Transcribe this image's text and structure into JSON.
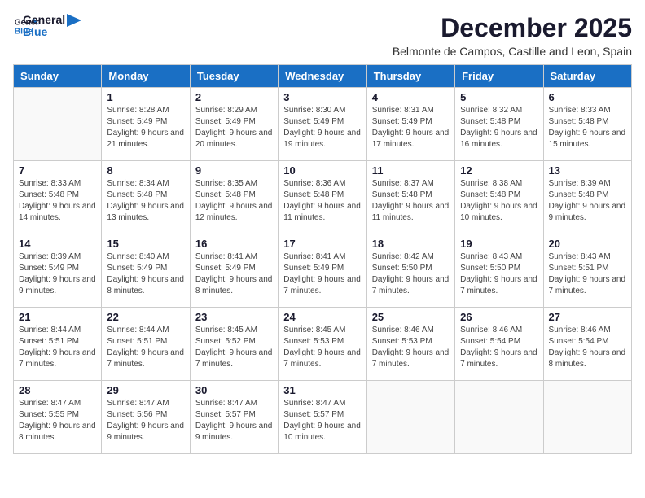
{
  "logo": {
    "text_general": "General",
    "text_blue": "Blue"
  },
  "title": "December 2025",
  "subtitle": "Belmonte de Campos, Castille and Leon, Spain",
  "days_of_week": [
    "Sunday",
    "Monday",
    "Tuesday",
    "Wednesday",
    "Thursday",
    "Friday",
    "Saturday"
  ],
  "weeks": [
    [
      {
        "day": "",
        "sunrise": "",
        "sunset": "",
        "daylight": ""
      },
      {
        "day": "1",
        "sunrise": "Sunrise: 8:28 AM",
        "sunset": "Sunset: 5:49 PM",
        "daylight": "Daylight: 9 hours and 21 minutes."
      },
      {
        "day": "2",
        "sunrise": "Sunrise: 8:29 AM",
        "sunset": "Sunset: 5:49 PM",
        "daylight": "Daylight: 9 hours and 20 minutes."
      },
      {
        "day": "3",
        "sunrise": "Sunrise: 8:30 AM",
        "sunset": "Sunset: 5:49 PM",
        "daylight": "Daylight: 9 hours and 19 minutes."
      },
      {
        "day": "4",
        "sunrise": "Sunrise: 8:31 AM",
        "sunset": "Sunset: 5:49 PM",
        "daylight": "Daylight: 9 hours and 17 minutes."
      },
      {
        "day": "5",
        "sunrise": "Sunrise: 8:32 AM",
        "sunset": "Sunset: 5:48 PM",
        "daylight": "Daylight: 9 hours and 16 minutes."
      },
      {
        "day": "6",
        "sunrise": "Sunrise: 8:33 AM",
        "sunset": "Sunset: 5:48 PM",
        "daylight": "Daylight: 9 hours and 15 minutes."
      }
    ],
    [
      {
        "day": "7",
        "sunrise": "Sunrise: 8:33 AM",
        "sunset": "Sunset: 5:48 PM",
        "daylight": "Daylight: 9 hours and 14 minutes."
      },
      {
        "day": "8",
        "sunrise": "Sunrise: 8:34 AM",
        "sunset": "Sunset: 5:48 PM",
        "daylight": "Daylight: 9 hours and 13 minutes."
      },
      {
        "day": "9",
        "sunrise": "Sunrise: 8:35 AM",
        "sunset": "Sunset: 5:48 PM",
        "daylight": "Daylight: 9 hours and 12 minutes."
      },
      {
        "day": "10",
        "sunrise": "Sunrise: 8:36 AM",
        "sunset": "Sunset: 5:48 PM",
        "daylight": "Daylight: 9 hours and 11 minutes."
      },
      {
        "day": "11",
        "sunrise": "Sunrise: 8:37 AM",
        "sunset": "Sunset: 5:48 PM",
        "daylight": "Daylight: 9 hours and 11 minutes."
      },
      {
        "day": "12",
        "sunrise": "Sunrise: 8:38 AM",
        "sunset": "Sunset: 5:48 PM",
        "daylight": "Daylight: 9 hours and 10 minutes."
      },
      {
        "day": "13",
        "sunrise": "Sunrise: 8:39 AM",
        "sunset": "Sunset: 5:48 PM",
        "daylight": "Daylight: 9 hours and 9 minutes."
      }
    ],
    [
      {
        "day": "14",
        "sunrise": "Sunrise: 8:39 AM",
        "sunset": "Sunset: 5:49 PM",
        "daylight": "Daylight: 9 hours and 9 minutes."
      },
      {
        "day": "15",
        "sunrise": "Sunrise: 8:40 AM",
        "sunset": "Sunset: 5:49 PM",
        "daylight": "Daylight: 9 hours and 8 minutes."
      },
      {
        "day": "16",
        "sunrise": "Sunrise: 8:41 AM",
        "sunset": "Sunset: 5:49 PM",
        "daylight": "Daylight: 9 hours and 8 minutes."
      },
      {
        "day": "17",
        "sunrise": "Sunrise: 8:41 AM",
        "sunset": "Sunset: 5:49 PM",
        "daylight": "Daylight: 9 hours and 7 minutes."
      },
      {
        "day": "18",
        "sunrise": "Sunrise: 8:42 AM",
        "sunset": "Sunset: 5:50 PM",
        "daylight": "Daylight: 9 hours and 7 minutes."
      },
      {
        "day": "19",
        "sunrise": "Sunrise: 8:43 AM",
        "sunset": "Sunset: 5:50 PM",
        "daylight": "Daylight: 9 hours and 7 minutes."
      },
      {
        "day": "20",
        "sunrise": "Sunrise: 8:43 AM",
        "sunset": "Sunset: 5:51 PM",
        "daylight": "Daylight: 9 hours and 7 minutes."
      }
    ],
    [
      {
        "day": "21",
        "sunrise": "Sunrise: 8:44 AM",
        "sunset": "Sunset: 5:51 PM",
        "daylight": "Daylight: 9 hours and 7 minutes."
      },
      {
        "day": "22",
        "sunrise": "Sunrise: 8:44 AM",
        "sunset": "Sunset: 5:51 PM",
        "daylight": "Daylight: 9 hours and 7 minutes."
      },
      {
        "day": "23",
        "sunrise": "Sunrise: 8:45 AM",
        "sunset": "Sunset: 5:52 PM",
        "daylight": "Daylight: 9 hours and 7 minutes."
      },
      {
        "day": "24",
        "sunrise": "Sunrise: 8:45 AM",
        "sunset": "Sunset: 5:53 PM",
        "daylight": "Daylight: 9 hours and 7 minutes."
      },
      {
        "day": "25",
        "sunrise": "Sunrise: 8:46 AM",
        "sunset": "Sunset: 5:53 PM",
        "daylight": "Daylight: 9 hours and 7 minutes."
      },
      {
        "day": "26",
        "sunrise": "Sunrise: 8:46 AM",
        "sunset": "Sunset: 5:54 PM",
        "daylight": "Daylight: 9 hours and 7 minutes."
      },
      {
        "day": "27",
        "sunrise": "Sunrise: 8:46 AM",
        "sunset": "Sunset: 5:54 PM",
        "daylight": "Daylight: 9 hours and 8 minutes."
      }
    ],
    [
      {
        "day": "28",
        "sunrise": "Sunrise: 8:47 AM",
        "sunset": "Sunset: 5:55 PM",
        "daylight": "Daylight: 9 hours and 8 minutes."
      },
      {
        "day": "29",
        "sunrise": "Sunrise: 8:47 AM",
        "sunset": "Sunset: 5:56 PM",
        "daylight": "Daylight: 9 hours and 9 minutes."
      },
      {
        "day": "30",
        "sunrise": "Sunrise: 8:47 AM",
        "sunset": "Sunset: 5:57 PM",
        "daylight": "Daylight: 9 hours and 9 minutes."
      },
      {
        "day": "31",
        "sunrise": "Sunrise: 8:47 AM",
        "sunset": "Sunset: 5:57 PM",
        "daylight": "Daylight: 9 hours and 10 minutes."
      },
      {
        "day": "",
        "sunrise": "",
        "sunset": "",
        "daylight": ""
      },
      {
        "day": "",
        "sunrise": "",
        "sunset": "",
        "daylight": ""
      },
      {
        "day": "",
        "sunrise": "",
        "sunset": "",
        "daylight": ""
      }
    ]
  ]
}
